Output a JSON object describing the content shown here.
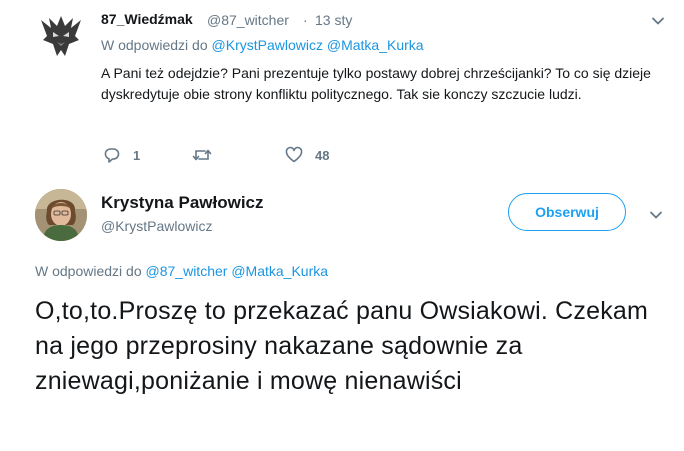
{
  "reply_tweet": {
    "author_name": "87_Wiedźmak",
    "author_handle": "@87_witcher",
    "separator": "·",
    "date": "13 sty",
    "reply_prefix": "W odpowiedzi do",
    "reply_mention_1": "@KrystPawlowicz",
    "reply_mention_2": "@Matka_Kurka",
    "text": "A Pani też odejdzie? Pani prezentuje tylko postawy dobrej chrześcijanki? To co się dzieje dyskredytuje obie strony konfliktu politycznego. Tak sie konczy szczucie ludzi.",
    "reply_count": "1",
    "retweet_count": "",
    "like_count": "48",
    "icons": {
      "reply": "reply-icon",
      "retweet": "retweet-icon",
      "like": "heart-icon",
      "menu": "chevron-down-icon",
      "avatar": "witcher-medallion-icon"
    }
  },
  "main_tweet": {
    "author_name": "Krystyna Pawłowicz",
    "author_handle": "@KrystPawlowicz",
    "follow_label": "Obserwuj",
    "reply_prefix": "W odpowiedzi do",
    "reply_mention_1": "@87_witcher",
    "reply_mention_2": "@Matka_Kurka",
    "text": "O,to,to.Proszę to przekazać panu Owsiakowi. Czekam na jego przeprosiny nakazane sądownie za zniewagi,poniżanie i mowę nienawiści"
  },
  "colors": {
    "accent": "#1da1f2",
    "link": "#1b95e0",
    "secondary_text": "#657786",
    "primary_text": "#14171a"
  }
}
